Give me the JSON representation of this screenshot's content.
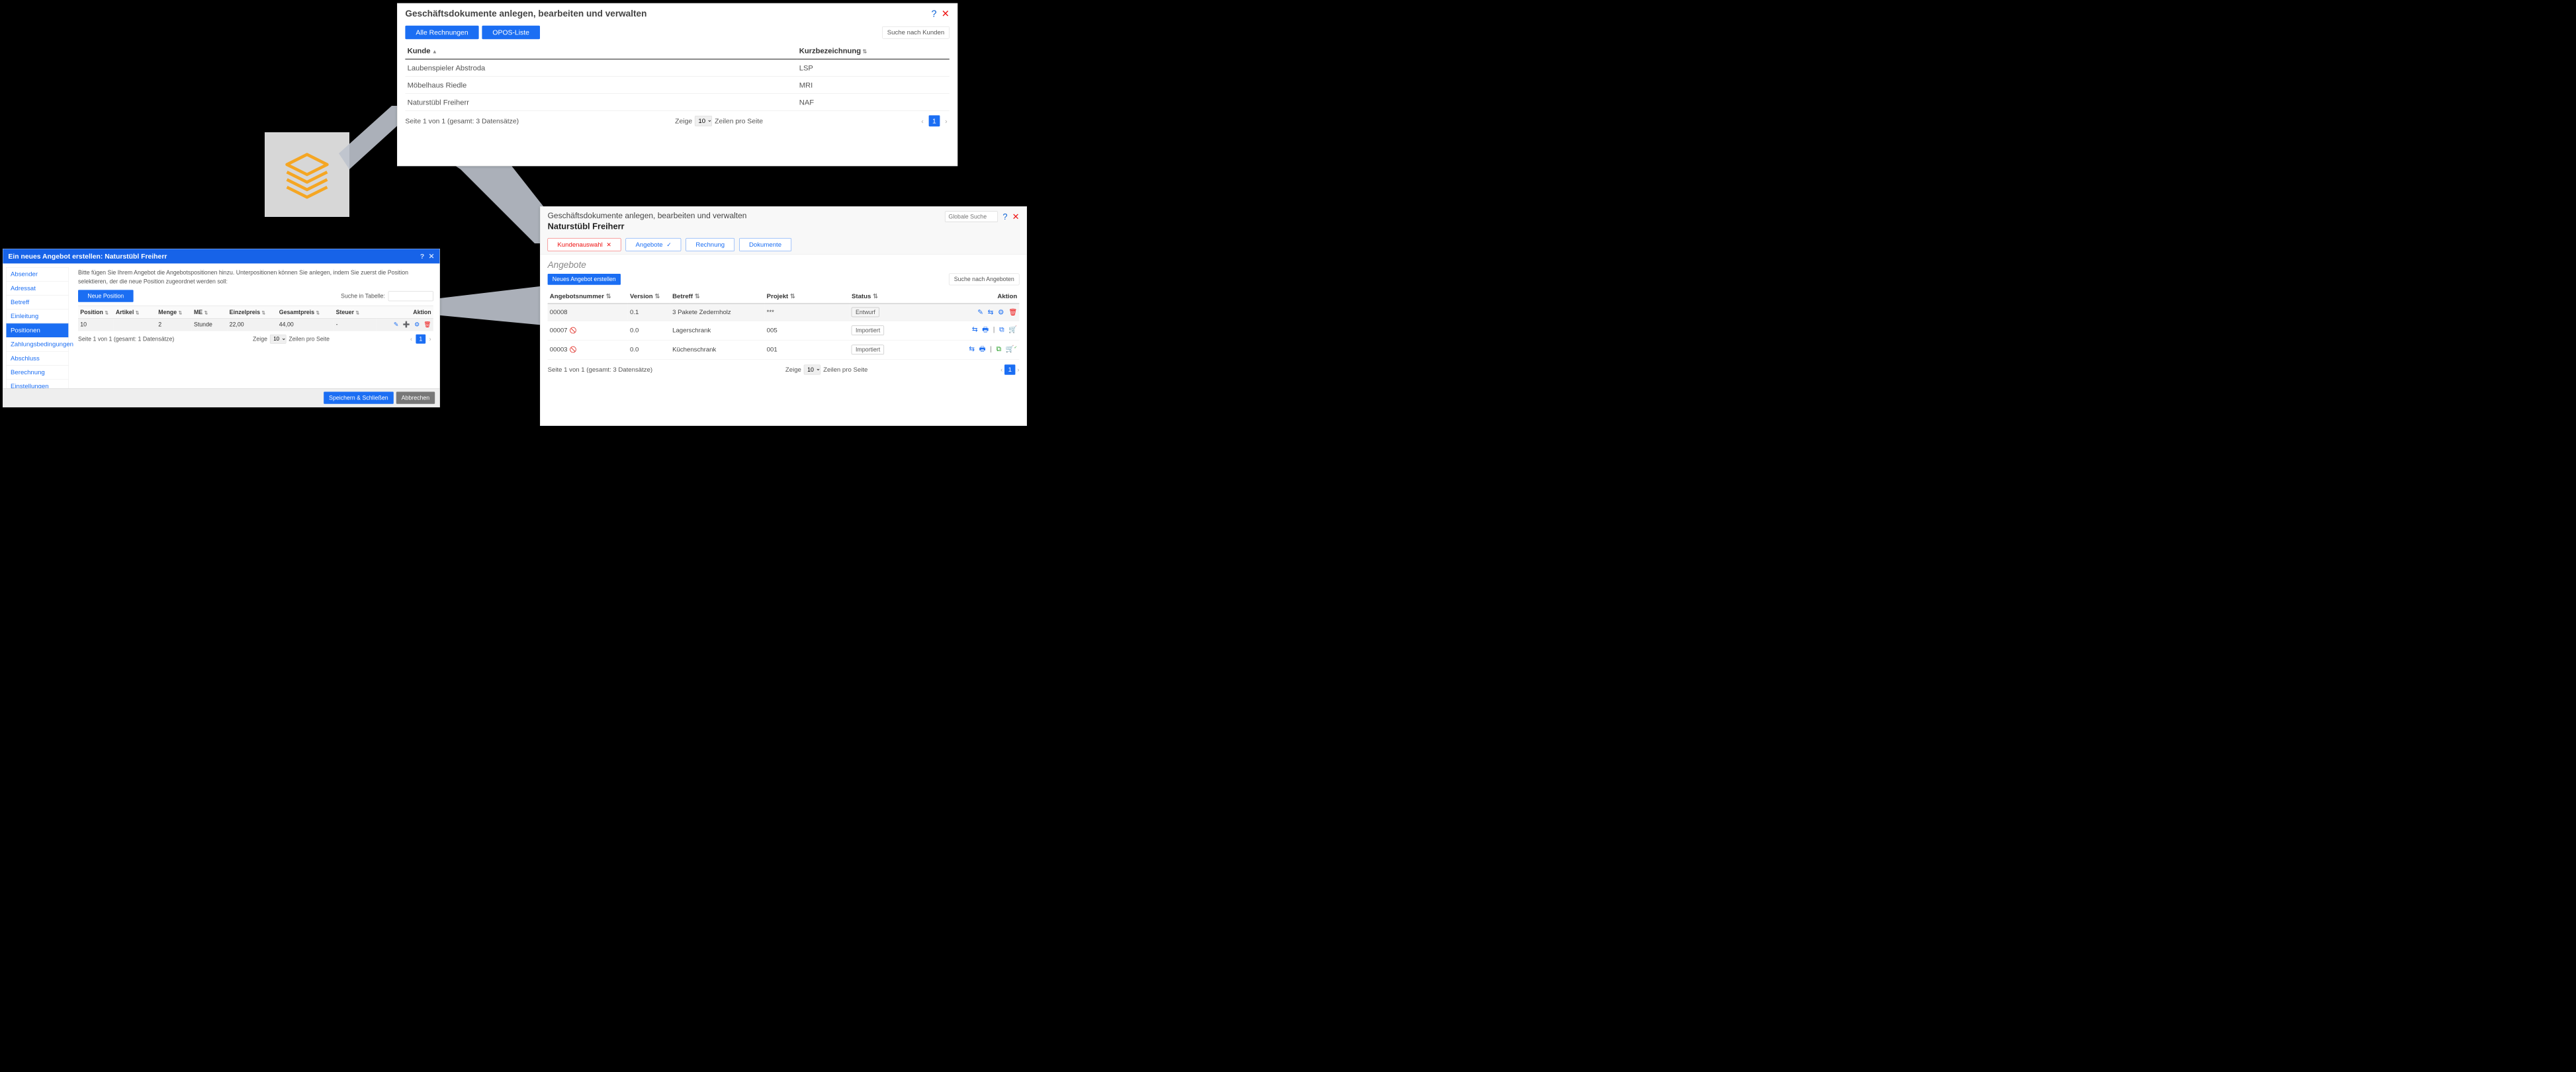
{
  "panel1": {
    "title": "Geschäftsdokumente anlegen, bearbeiten und verwalten",
    "btn_all_invoices": "Alle Rechnungen",
    "btn_opos": "OPOS-Liste",
    "search_placeholder": "Suche nach Kunden",
    "col_customer": "Kunde",
    "col_short": "Kurzbezeichnung",
    "rows": [
      {
        "kunde": "Laubenspieler Abstroda",
        "kurz": "LSP"
      },
      {
        "kunde": "Möbelhaus Riedle",
        "kurz": "MRI"
      },
      {
        "kunde": "Naturstübl Freiherr",
        "kurz": "NAF"
      }
    ],
    "pager_text": "Seite 1 von 1 (gesamt: 3 Datensätze)",
    "show_label": "Zeige",
    "per_page": "10",
    "rows_label": "Zeilen pro Seite",
    "page_current": "1"
  },
  "panel2": {
    "title": "Geschäftsdokumente anlegen, bearbeiten und verwalten",
    "subtitle": "Naturstübl Freiherr",
    "global_search_placeholder": "Globale Suche",
    "tabs": {
      "kunde": "Kundenauswahl",
      "angebote": "Angebote",
      "rechnung": "Rechnung",
      "dokumente": "Dokumente"
    },
    "section": "Angebote",
    "new_offer": "Neues Angebot erstellen",
    "search_offers_placeholder": "Suche nach Angeboten",
    "cols": {
      "nr": "Angebotsnummer",
      "ver": "Version",
      "betreff": "Betreff",
      "projekt": "Projekt",
      "status": "Status",
      "aktion": "Aktion"
    },
    "rows": [
      {
        "nr": "00008",
        "hidden": false,
        "ver": "0.1",
        "betreff": "3 Pakete Zedernholz",
        "projekt": "***",
        "status": "Entwurf",
        "actions": "edit"
      },
      {
        "nr": "00007",
        "hidden": true,
        "ver": "0.0",
        "betreff": "Lagerschrank",
        "projekt": "005",
        "status": "Importiert",
        "actions": "import"
      },
      {
        "nr": "00003",
        "hidden": true,
        "ver": "0.0",
        "betreff": "Küchenschrank",
        "projekt": "001",
        "status": "Importiert",
        "actions": "import-green"
      }
    ],
    "pager_text": "Seite 1 von 1 (gesamt: 3 Datensätze)",
    "show_label": "Zeige",
    "per_page": "10",
    "rows_label": "Zeilen pro Seite",
    "page_current": "1"
  },
  "panel3": {
    "title": "Ein neues Angebot erstellen: Naturstübl Freiherr",
    "sidebar": [
      "Absender",
      "Adressat",
      "Betreff",
      "Einleitung",
      "Positionen",
      "Zahlungsbedingungen",
      "Abschluss",
      "Berechnung",
      "Einstellungen"
    ],
    "active_index": 4,
    "intro": "Bitte fügen Sie Ihrem Angebot die Angebotspositionen hinzu. Unterpositionen können Sie anlegen, indem Sie zuerst die Position selektieren, der die neue Position zugeordnet werden soll:",
    "new_position": "Neue Position",
    "search_label": "Suche in Tabelle:",
    "cols": {
      "pos": "Position",
      "art": "Artikel",
      "menge": "Menge",
      "me": "ME",
      "ep": "Einzelpreis",
      "gp": "Gesamtpreis",
      "steuer": "Steuer",
      "aktion": "Aktion"
    },
    "row": {
      "pos": "10",
      "art": "",
      "menge": "2",
      "me": "Stunde",
      "ep": "22,00",
      "gp": "44,00",
      "steuer": "-"
    },
    "pager_text": "Seite 1 von 1 (gesamt: 1 Datensätze)",
    "show_label": "Zeige",
    "per_page": "10",
    "rows_label": "Zeilen pro Seite",
    "page_current": "1",
    "save": "Speichern & Schließen",
    "cancel": "Abbrechen"
  }
}
